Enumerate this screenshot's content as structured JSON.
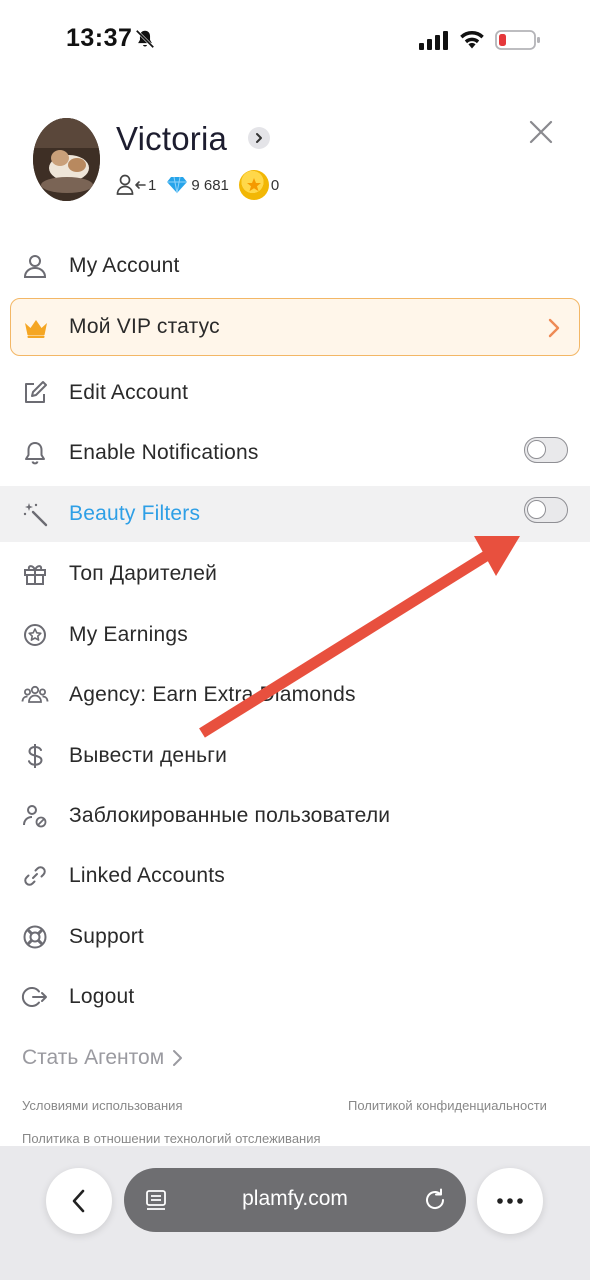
{
  "status_bar": {
    "time": "13:37",
    "icons": [
      "bell-off-icon",
      "cellular-signal-icon",
      "wifi-icon",
      "battery-low-icon"
    ]
  },
  "profile": {
    "name": "Victoria",
    "followers": "1",
    "diamonds": "9 681",
    "coins": "0"
  },
  "menu": {
    "items": [
      {
        "label": "My Account",
        "icon": "user-icon"
      },
      {
        "label": "Мой VIP статус",
        "icon": "crown-icon"
      },
      {
        "label": "Edit Account",
        "icon": "edit-icon"
      },
      {
        "label": "Enable Notifications",
        "icon": "bell-icon",
        "toggle": false
      },
      {
        "label": "Beauty Filters",
        "icon": "magic-wand-icon",
        "toggle": false
      },
      {
        "label": "Топ Дарителей",
        "icon": "gift-icon"
      },
      {
        "label": "My Earnings",
        "icon": "star-circle-icon"
      },
      {
        "label": "Agency: Earn Extra Diamonds",
        "icon": "group-icon"
      },
      {
        "label": "Вывести деньги",
        "icon": "dollar-icon"
      },
      {
        "label": "Заблокированные пользователи",
        "icon": "user-blocked-icon"
      },
      {
        "label": "Linked Accounts",
        "icon": "link-icon"
      },
      {
        "label": "Support",
        "icon": "lifebuoy-icon"
      },
      {
        "label": "Logout",
        "icon": "logout-icon"
      }
    ]
  },
  "footer": {
    "become_agent": "Стать Агентом",
    "terms": "Условиями использования",
    "privacy": "Политикой конфиденциальности",
    "tracking": "Политика в отношении технологий отслеживания"
  },
  "browser": {
    "url": "plamfy.com"
  },
  "colors": {
    "accent_blue": "#2e9fe6",
    "vip_border": "#f3b766",
    "vip_bg": "#fff6ea",
    "annotation_arrow": "#e8503e"
  }
}
